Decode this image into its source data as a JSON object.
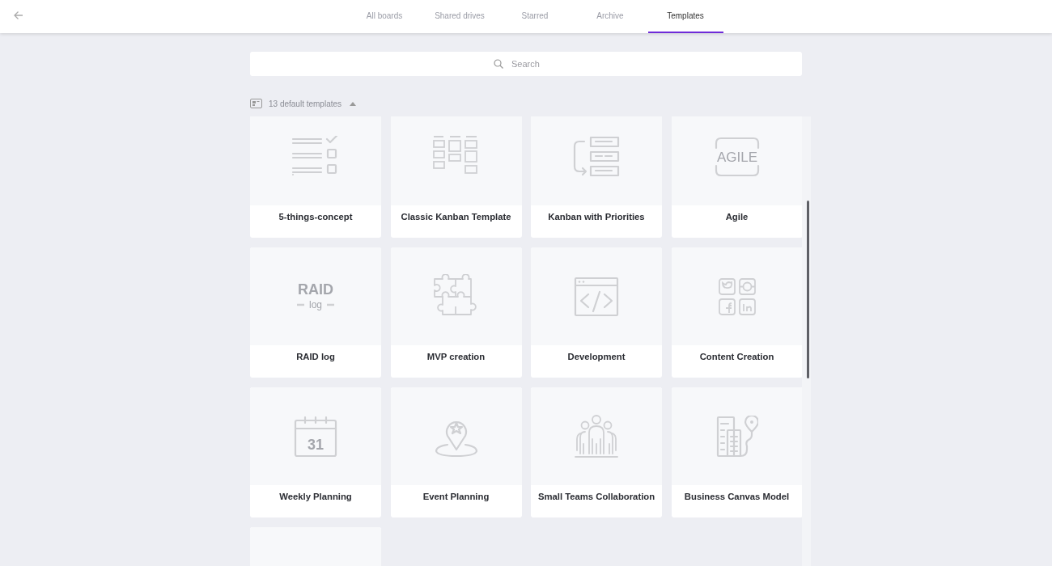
{
  "tabs": [
    {
      "label": "All boards",
      "selected": false
    },
    {
      "label": "Shared drives",
      "selected": false
    },
    {
      "label": "Starred",
      "selected": false
    },
    {
      "label": "Archive",
      "selected": false
    },
    {
      "label": "Templates",
      "selected": true
    }
  ],
  "search": {
    "placeholder": "Search"
  },
  "section": {
    "label": "13 default templates",
    "expanded": true
  },
  "templates": [
    {
      "kind": "checklist",
      "title": "5-things-concept"
    },
    {
      "kind": "kanban",
      "title": "Classic Kanban Template"
    },
    {
      "kind": "priorities",
      "title": "Kanban with Priorities"
    },
    {
      "kind": "agile",
      "title": "Agile",
      "icon_text": [
        "AGILE"
      ]
    },
    {
      "kind": "raid",
      "title": "RAID log",
      "icon_text": [
        "RAID",
        "log"
      ]
    },
    {
      "kind": "puzzle",
      "title": "MVP creation"
    },
    {
      "kind": "code",
      "title": "Development"
    },
    {
      "kind": "social",
      "title": "Content Creation"
    },
    {
      "kind": "calendar",
      "title": "Weekly Planning",
      "icon_text": [
        "31"
      ]
    },
    {
      "kind": "pin",
      "title": "Event Planning"
    },
    {
      "kind": "team",
      "title": "Small Teams Collaboration"
    },
    {
      "kind": "building",
      "title": "Business Canvas Model"
    },
    {
      "kind": "partial"
    }
  ]
}
